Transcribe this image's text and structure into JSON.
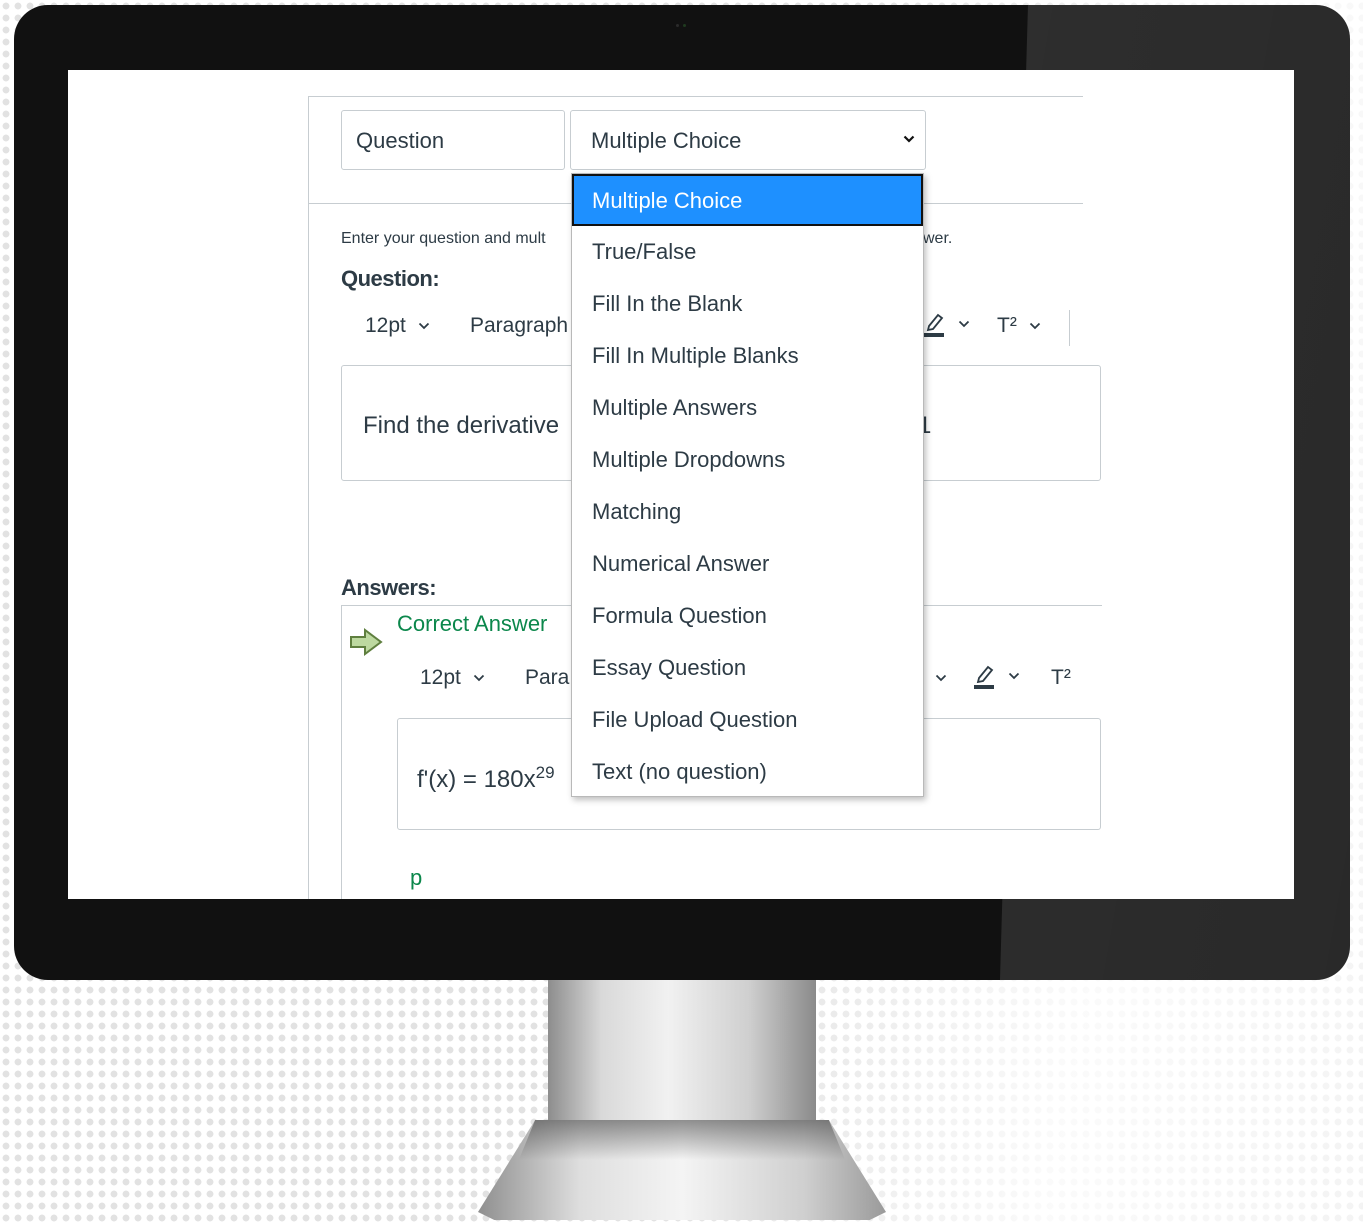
{
  "question_form": {
    "name_value": "Question",
    "type_select_value": "Multiple Choice",
    "help_text_start": "Enter your question and mult",
    "help_text_end": "wer.",
    "question_heading": "Question:",
    "toolbar": {
      "font_size": "12pt",
      "block_format": "Paragraph",
      "superscript_label": "T²"
    },
    "question_text_start": "Find the derivative",
    "question_text_end": "1",
    "answers_heading": "Answers:",
    "correct_answer_label": "Correct Answer",
    "answer_toolbar": {
      "font_size": "12pt",
      "block_format": "Para",
      "superscript_label": "T²"
    },
    "answer_text_base": "f'(x) = 180x",
    "answer_text_sup": "29",
    "status_path": "p"
  },
  "question_type_dropdown": {
    "selected_index": 0,
    "options": [
      "Multiple Choice",
      "True/False",
      "Fill In the Blank",
      "Fill In Multiple Blanks",
      "Multiple Answers",
      "Multiple Dropdowns",
      "Matching",
      "Numerical Answer",
      "Formula Question",
      "Essay Question",
      "File Upload Question",
      "Text (no question)"
    ]
  },
  "colors": {
    "selected_option_bg": "#1e90ff",
    "correct_answer_green": "#0b874b",
    "text": "#2d3b45",
    "bezel": "#111111"
  }
}
